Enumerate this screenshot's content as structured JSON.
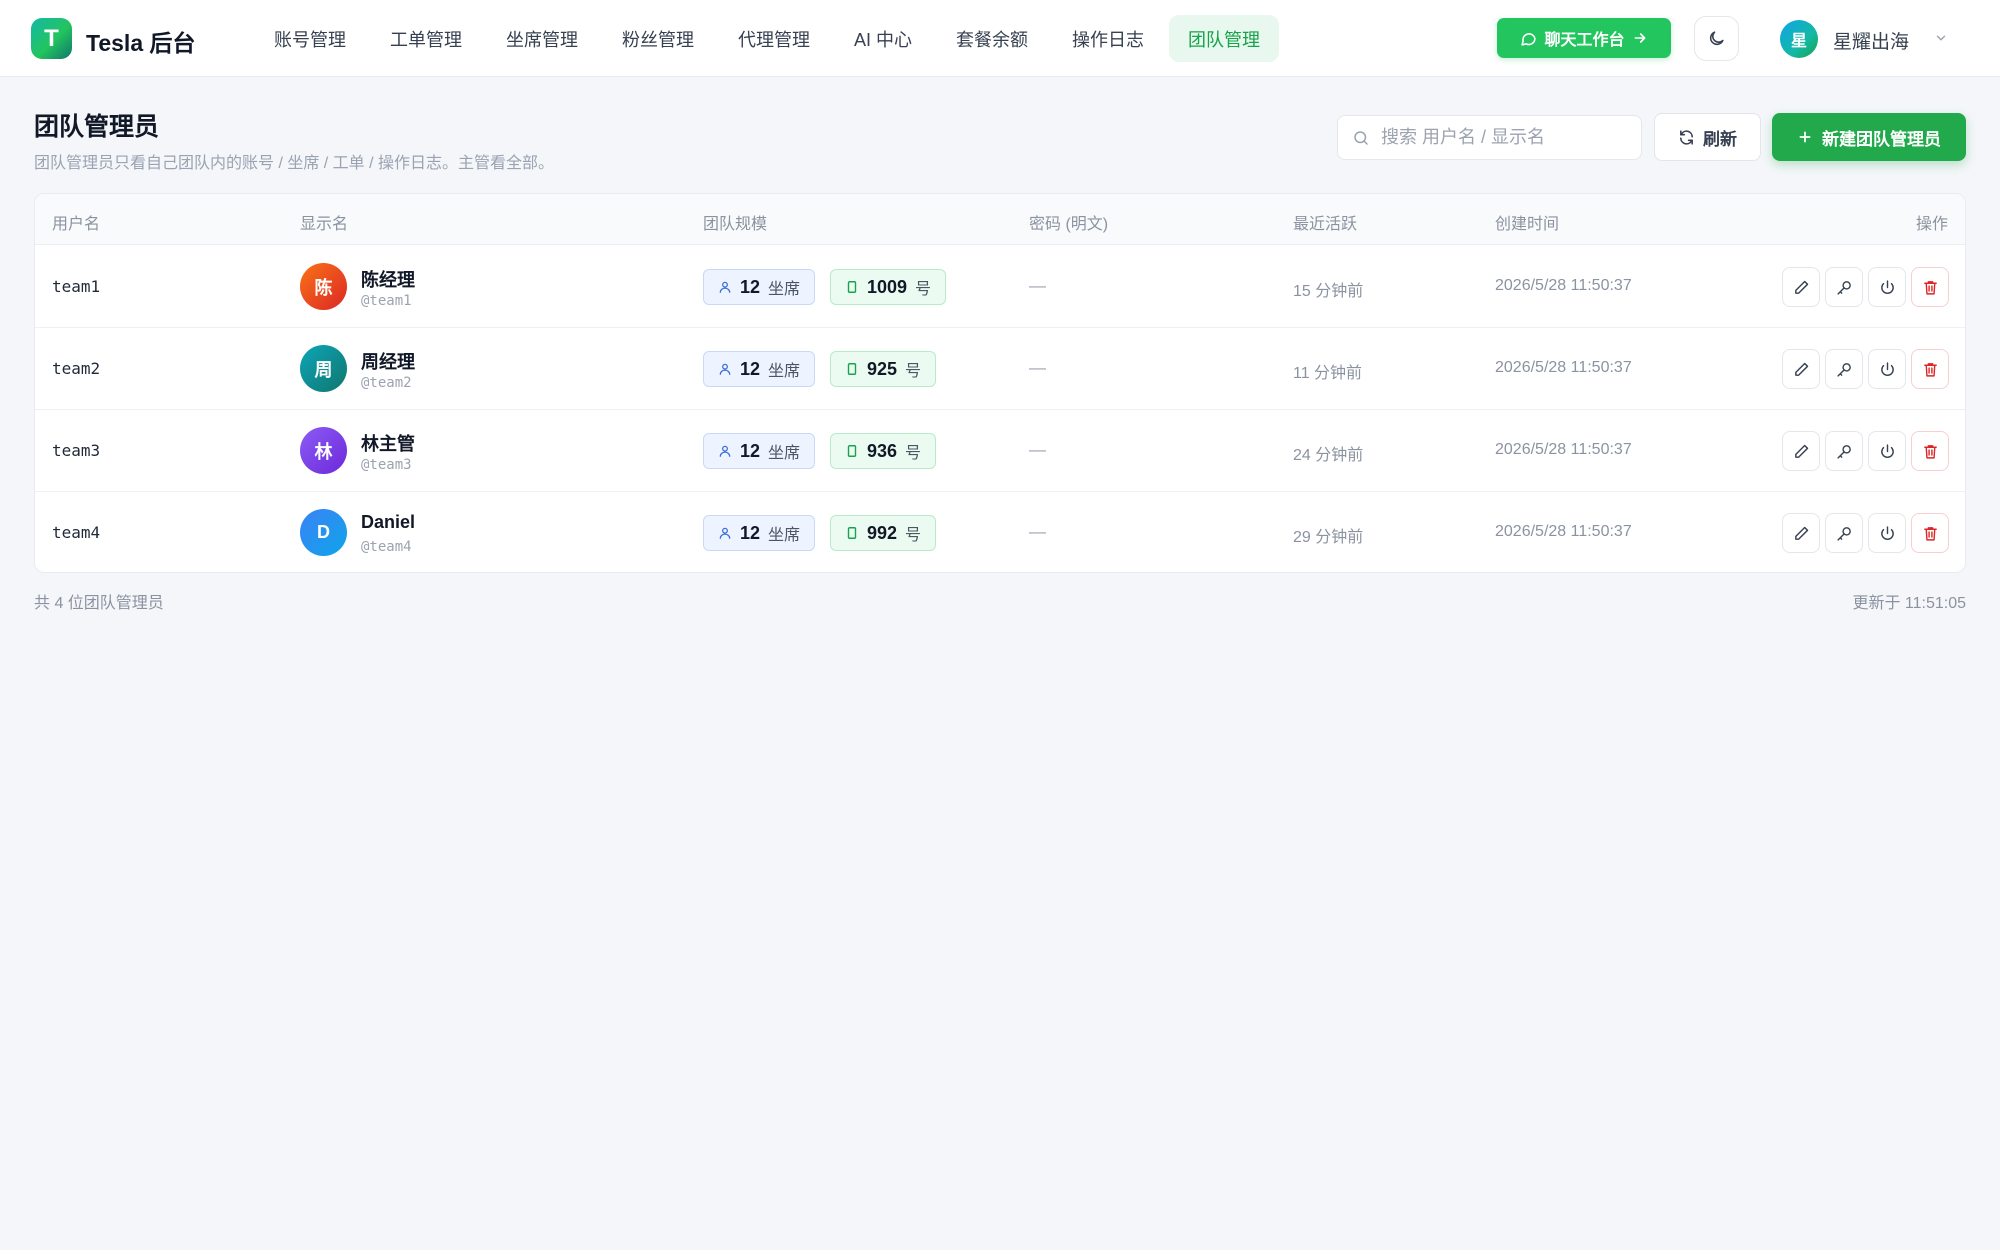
{
  "app": {
    "logo_letter": "T",
    "brand": "Tesla 后台"
  },
  "nav": {
    "items": [
      {
        "label": "账号管理",
        "active": false
      },
      {
        "label": "工单管理",
        "active": false
      },
      {
        "label": "坐席管理",
        "active": false
      },
      {
        "label": "粉丝管理",
        "active": false
      },
      {
        "label": "代理管理",
        "active": false
      },
      {
        "label": "AI 中心",
        "active": false
      },
      {
        "label": "套餐余额",
        "active": false
      },
      {
        "label": "操作日志",
        "active": false
      },
      {
        "label": "团队管理",
        "active": true
      }
    ],
    "chat_button": "聊天工作台",
    "theme_icon": "moon-icon"
  },
  "user": {
    "avatar_letter": "星",
    "name": "星耀出海"
  },
  "page": {
    "title": "团队管理员",
    "subtitle": "团队管理员只看自己团队内的账号 / 坐席 / 工单 / 操作日志。主管看全部。",
    "search_placeholder": "搜索 用户名 / 显示名",
    "refresh_label": "刷新",
    "new_label": "新建团队管理员"
  },
  "table": {
    "headers": {
      "username": "用户名",
      "display_name": "显示名",
      "team_size": "团队规模",
      "password": "密码 (明文)",
      "last_active": "最近活跃",
      "created": "创建时间",
      "actions": "操作"
    },
    "seat_unit": "坐席",
    "account_unit": "号",
    "rows": [
      {
        "username": "team1",
        "avatar_letter": "陈",
        "avatar_color": "#ea580c",
        "display_name": "陈经理",
        "handle": "@team1",
        "seats": "12",
        "accounts": "1009",
        "password": "—",
        "last_active": "15 分钟前",
        "created": "2026/5/28 11:50:37"
      },
      {
        "username": "team2",
        "avatar_letter": "周",
        "avatar_color": "#0e8f9e",
        "display_name": "周经理",
        "handle": "@team2",
        "seats": "12",
        "accounts": "925",
        "password": "—",
        "last_active": "11 分钟前",
        "created": "2026/5/28 11:50:37"
      },
      {
        "username": "team3",
        "avatar_letter": "林",
        "avatar_color": "#7c3aed",
        "display_name": "林主管",
        "handle": "@team3",
        "seats": "12",
        "accounts": "936",
        "password": "—",
        "last_active": "24 分钟前",
        "created": "2026/5/28 11:50:37"
      },
      {
        "username": "team4",
        "avatar_letter": "D",
        "avatar_color": "#1d7fe0",
        "display_name": "Daniel",
        "handle": "@team4",
        "seats": "12",
        "accounts": "992",
        "password": "—",
        "last_active": "29 分钟前",
        "created": "2026/5/28 11:50:37"
      }
    ],
    "action_icons": [
      "edit-icon",
      "key-icon",
      "power-icon",
      "trash-icon"
    ]
  },
  "footer": {
    "count_text": "共 4 位团队管理员",
    "updated_text": "更新于 11:51:05"
  },
  "colors": {
    "accent": "#22c55e",
    "accent_dark": "#16a34a",
    "danger": "#dc2626",
    "background": "#f4f6f9"
  }
}
